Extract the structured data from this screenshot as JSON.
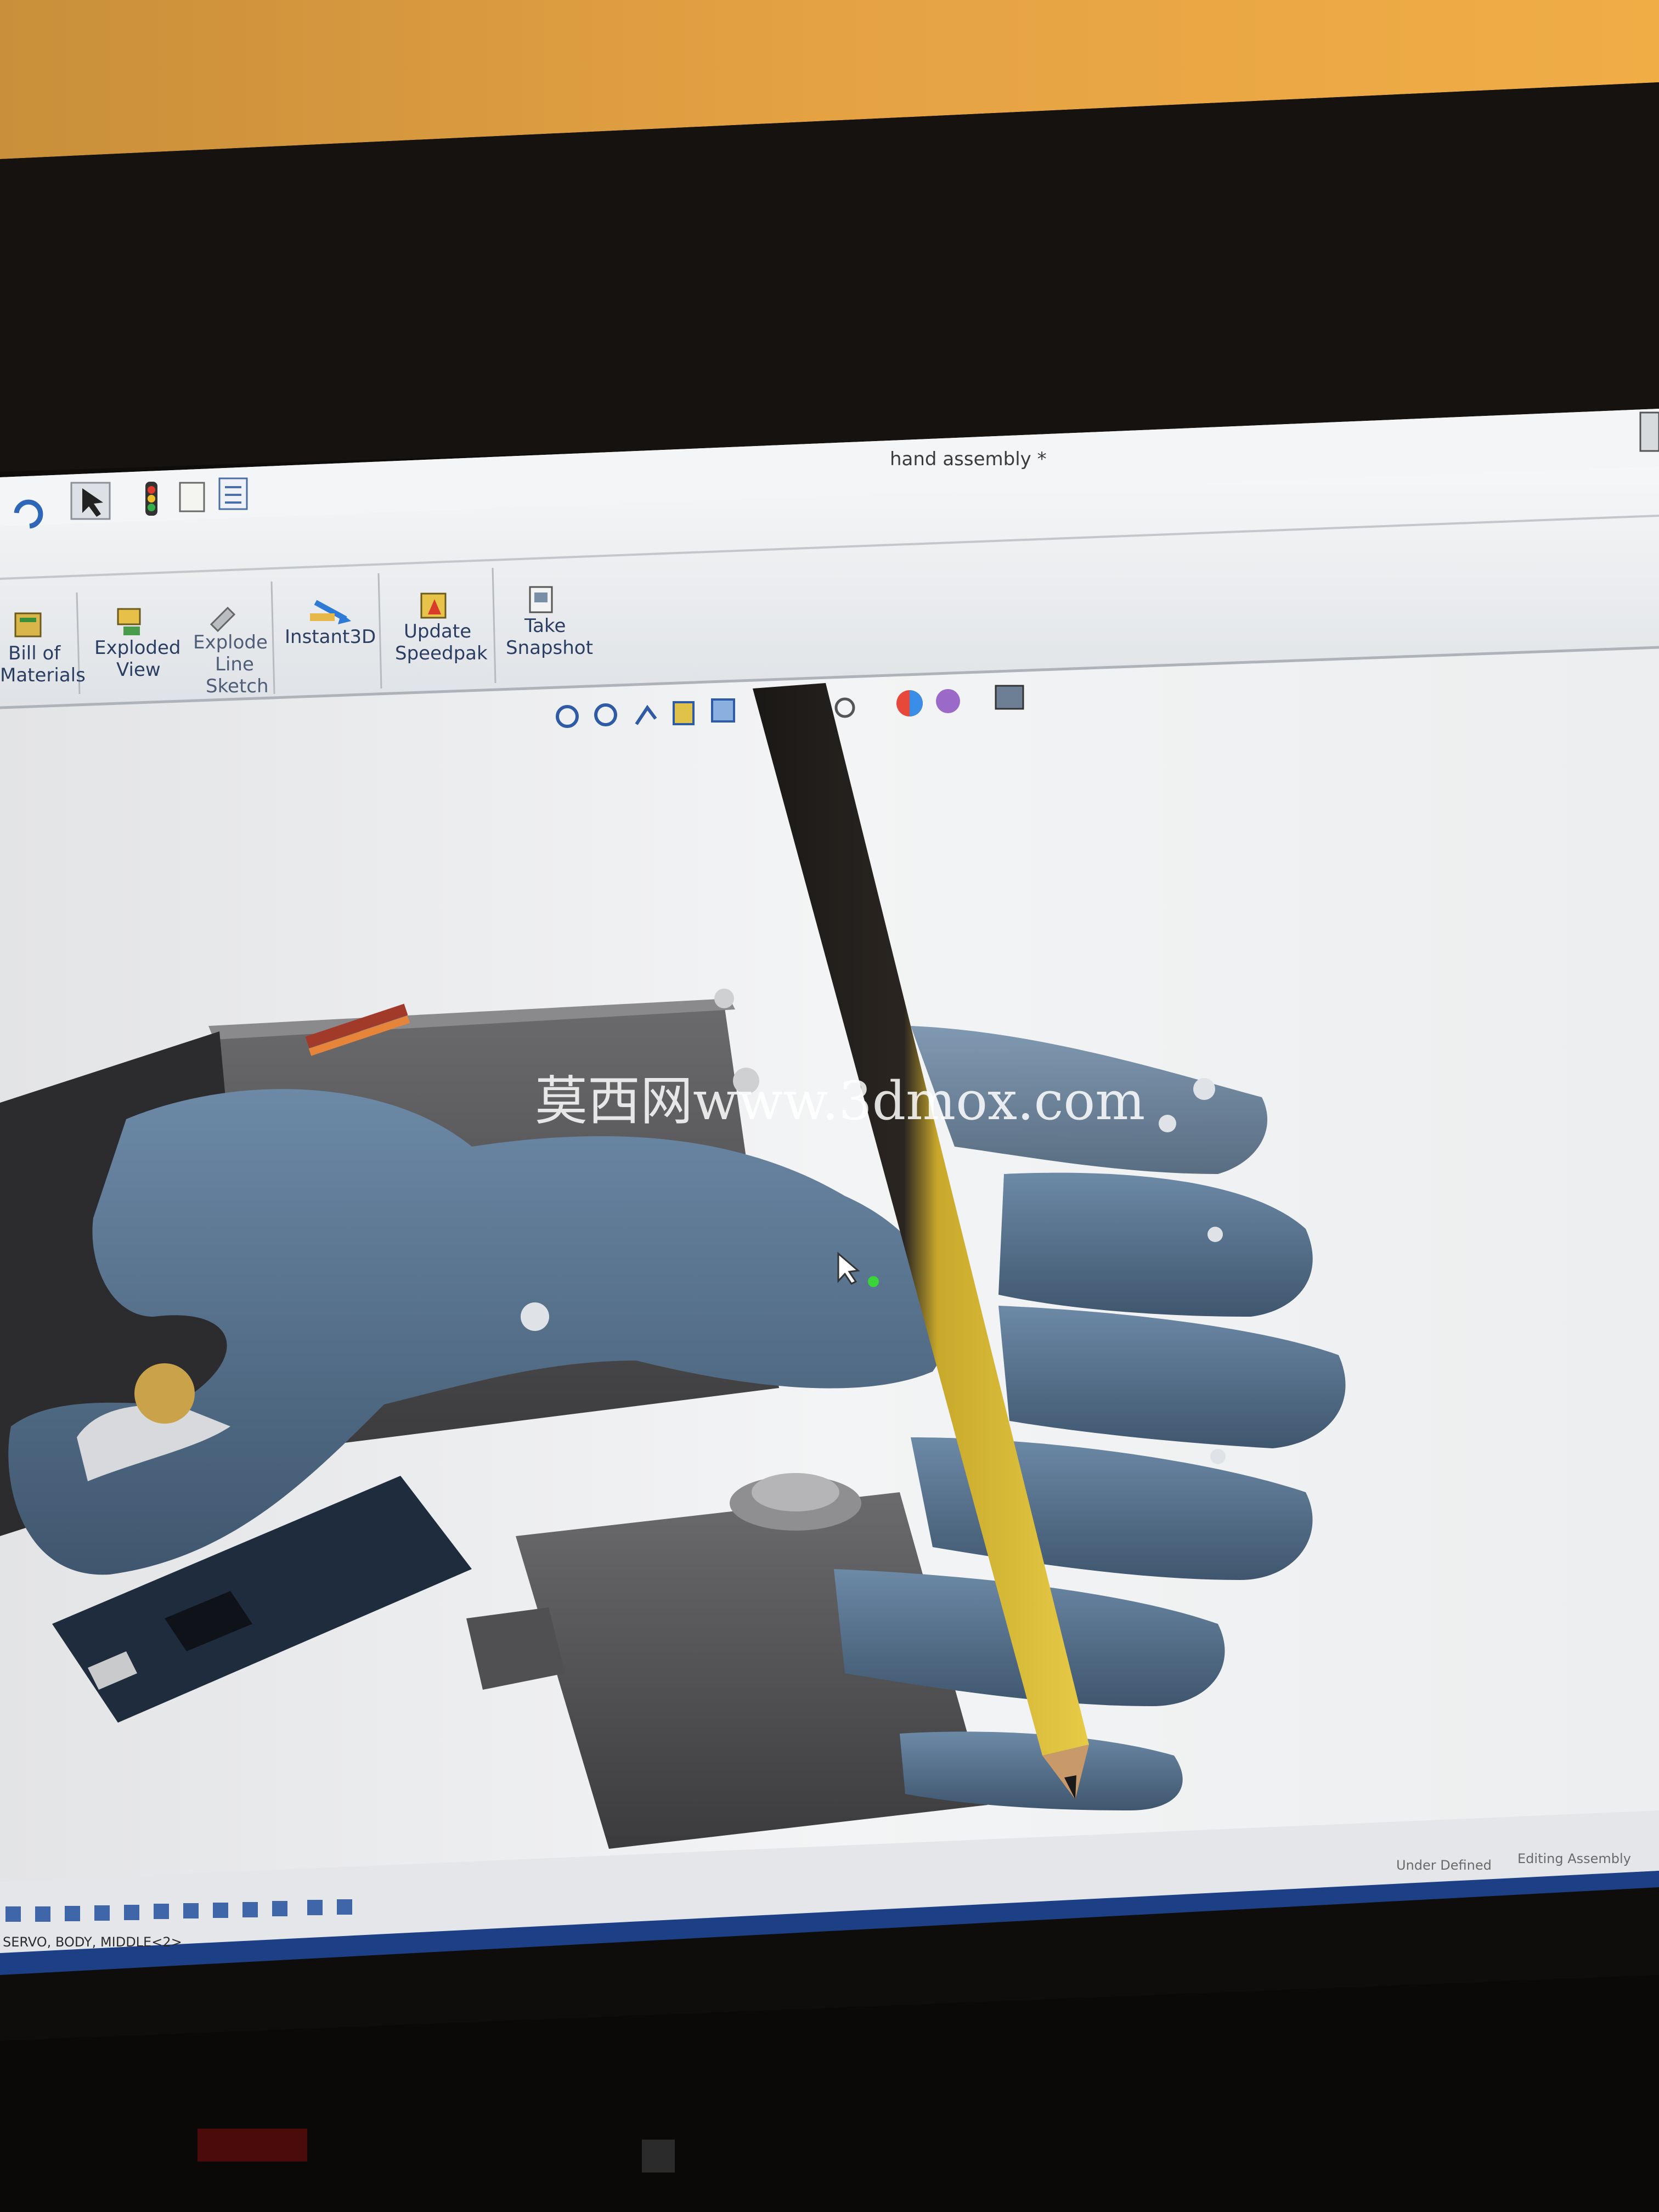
{
  "window": {
    "title": "hand assembly *"
  },
  "ribbon": {
    "commands": [
      {
        "line1": "Bill of",
        "line2": "Materials",
        "line3": ""
      },
      {
        "line1": "Exploded",
        "line2": "View",
        "line3": ""
      },
      {
        "line1": "Explode",
        "line2": "Line",
        "line3": "Sketch"
      },
      {
        "line1": "Instant3D",
        "line2": "",
        "line3": ""
      },
      {
        "line1": "Update",
        "line2": "Speedpak",
        "line3": ""
      },
      {
        "line1": "Take",
        "line2": "Snapshot",
        "line3": ""
      }
    ]
  },
  "status_bar": {
    "left": "SERVO, BODY, MIDDLE<2>",
    "state": "Under Defined",
    "mode": "Editing Assembly"
  },
  "watermark": "莫西网www.3dmox.com",
  "icons": {
    "undo": "undo-icon",
    "select": "select-pointer-icon",
    "rebuild": "traffic-light-icon",
    "file_properties": "file-properties-icon",
    "options": "options-list-icon",
    "zoom_fit": "zoom-to-fit-icon",
    "zoom_area": "zoom-to-area-icon",
    "previous_view": "previous-view-icon",
    "section_view": "section-view-icon",
    "view_orientation": "view-orientation-icon",
    "display_style": "display-style-icon",
    "hide_show": "hide-show-items-icon",
    "appearance": "edit-appearance-icon",
    "scene": "apply-scene-icon",
    "view_settings": "view-settings-icon"
  },
  "colors": {
    "wall": "#e8a642",
    "ui_bg": "#eef0f2",
    "part_blue": "#5f7a95",
    "servo_gray": "#5b5b5d",
    "pencil": "#d8b933"
  }
}
